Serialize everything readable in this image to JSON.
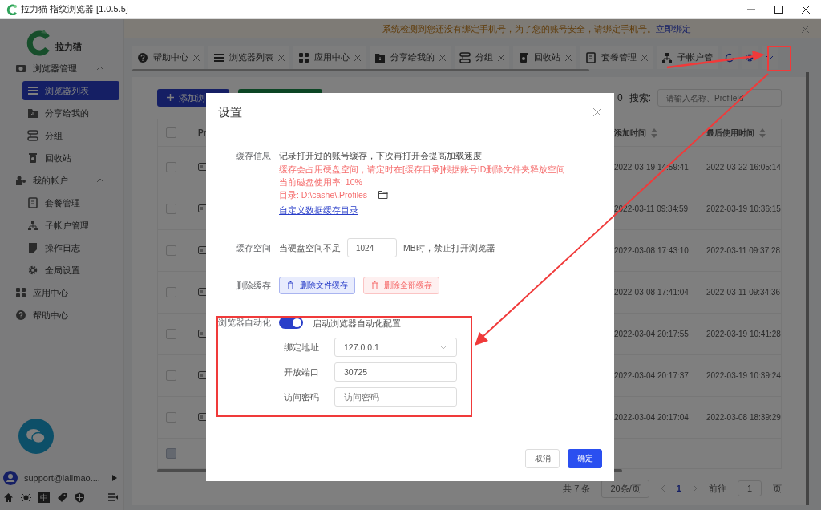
{
  "window": {
    "title": "拉力猫 指纹浏览器  [1.0.5.5]"
  },
  "sidebar": {
    "logo_text": "拉力猫",
    "menu": [
      {
        "label": "浏览器管理",
        "expanded": true,
        "children": [
          {
            "label": "浏览器列表",
            "selected": true
          },
          {
            "label": "分享给我的",
            "selected": false
          },
          {
            "label": "分组",
            "selected": false
          },
          {
            "label": "回收站",
            "selected": false
          }
        ]
      },
      {
        "label": "我的帐户",
        "expanded": true,
        "children": [
          {
            "label": "套餐管理",
            "selected": false
          },
          {
            "label": "子帐户管理",
            "selected": false
          },
          {
            "label": "操作日志",
            "selected": false
          },
          {
            "label": "全局设置",
            "selected": false
          }
        ]
      },
      {
        "label": "应用中心"
      },
      {
        "label": "帮助中心"
      }
    ],
    "user": "support@lalimao....",
    "language": "中"
  },
  "banner": {
    "message": "系统检测到您还没有绑定手机号，为了您的账号安全，请绑定手机号。",
    "link": "立即绑定"
  },
  "tabs": [
    {
      "label": "帮助中心",
      "closable": true
    },
    {
      "label": "浏览器列表",
      "closable": true
    },
    {
      "label": "应用中心",
      "closable": true
    },
    {
      "label": "分享给我的",
      "closable": true
    },
    {
      "label": "分组",
      "closable": true
    },
    {
      "label": "回收站",
      "closable": true
    },
    {
      "label": "套餐管理",
      "closable": true
    },
    {
      "label": "子帐户管",
      "closable": false
    }
  ],
  "toolbar": {
    "add_button": "添加浏",
    "count_fragment": "0",
    "search_label": "搜索:",
    "search_placeholder": "请输入名称、ProfileId"
  },
  "table": {
    "header_checked": false,
    "footer_checkbox": {
      "disabled": true
    },
    "columns": [
      {
        "label": "Pr",
        "sortable": false
      },
      {
        "label": "添加时间",
        "sortable": true
      },
      {
        "label": "最后使用时间",
        "sortable": true
      }
    ],
    "rows": [
      {
        "checked": false,
        "added": "2022-03-19 14:59:41",
        "last_used": "2022-03-22 16:05:14"
      },
      {
        "checked": false,
        "added": "2022-03-11 09:34:59",
        "last_used": "2022-03-19 10:36:15"
      },
      {
        "checked": false,
        "added": "2022-03-08 17:43:10",
        "last_used": "2022-03-11 09:37:28"
      },
      {
        "checked": false,
        "added": "2022-03-08 17:41:04",
        "last_used": "2022-03-11 09:34:36"
      },
      {
        "checked": false,
        "added": "2022-03-04 20:17:55",
        "last_used": "2022-03-19 10:41:28"
      },
      {
        "checked": false,
        "added": "2022-03-04 20:17:37",
        "last_used": "2022-03-19 10:39:24"
      },
      {
        "checked": false,
        "added": "2022-03-04 20:17:04",
        "last_used": "2022-03-08 18:39:29"
      }
    ]
  },
  "pagination": {
    "total": "共 7 条",
    "page_size": "20条/页",
    "current": "1",
    "goto_label": "前往",
    "goto_value": "1",
    "page_unit": "页"
  },
  "dialog": {
    "title": "设置",
    "cache_info": {
      "label": "缓存信息",
      "description": "记录打开过的账号缓存，下次再打开会提高加载速度",
      "warnings": [
        "缓存会占用硬盘空间，请定时在[缓存目录]根据账号ID删除文件夹释放空间",
        "当前磁盘使用率: 10%",
        "目录: D:\\cashe\\.Profiles"
      ],
      "link": "自定义数据缓存目录"
    },
    "cache_space": {
      "label": "缓存空间",
      "prefix": "当硬盘空间不足",
      "value": "1024",
      "suffix": "MB时，禁止打开浏览器"
    },
    "delete_cache": {
      "label": "删除缓存",
      "buttons": [
        {
          "label": "删除文件缓存",
          "kind": "primary"
        },
        {
          "label": "删除全部缓存",
          "kind": "danger"
        }
      ]
    },
    "automation": {
      "label": "浏览器自动化",
      "on": true,
      "toggle_text": "启动浏览器自动化配置",
      "fields": [
        {
          "label": "绑定地址",
          "kind": "select",
          "value": "127.0.0.1"
        },
        {
          "label": "开放端口",
          "kind": "input",
          "value": "30725"
        },
        {
          "label": "访问密码",
          "kind": "input",
          "placeholder": "访问密码"
        }
      ]
    },
    "buttons": {
      "cancel": "取消",
      "confirm": "确定"
    }
  }
}
